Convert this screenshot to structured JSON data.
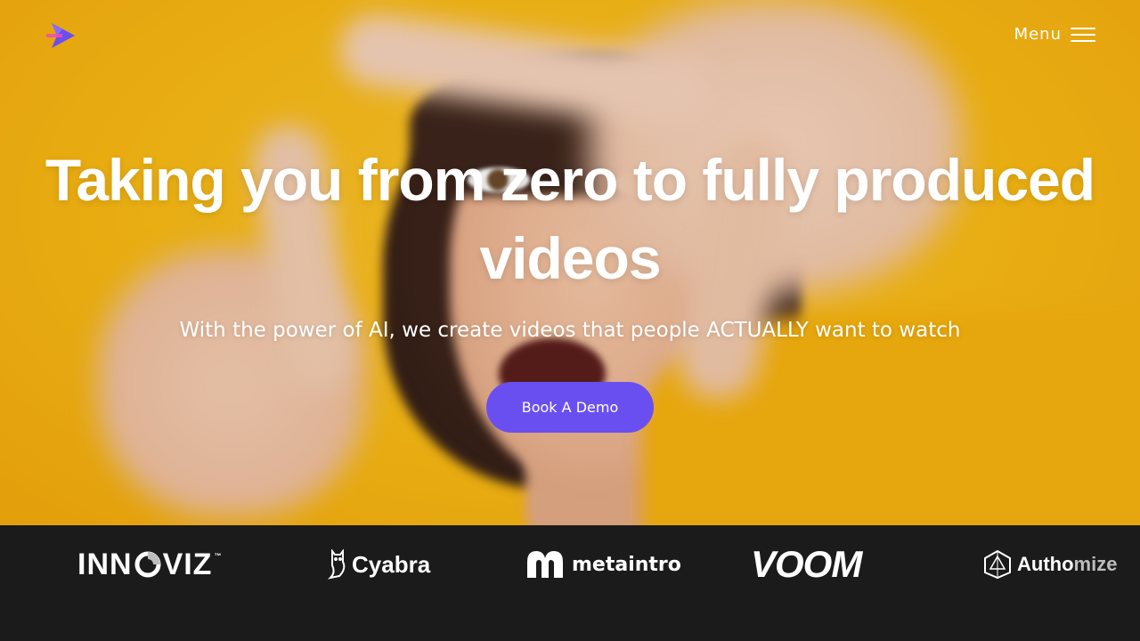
{
  "header": {
    "logo_icon": "play-arrow-logo-icon",
    "menu_label": "Menu",
    "menu_icon": "hamburger-icon"
  },
  "hero": {
    "headline": "Taking you from zero to fully produced videos",
    "subheadline": "With the power of AI, we create videos that people ACTUALLY want to watch",
    "cta_label": "Book A Demo",
    "accent_color": "#6a4ff0",
    "background_color": "#f7b814"
  },
  "clients": {
    "innoviz": {
      "name_part1": "INN",
      "name_part2": "VIZ",
      "tm": "™"
    },
    "cyabra": {
      "name": "Cyabra"
    },
    "metaintro": {
      "name": "metaintro"
    },
    "voom": {
      "name": "VOOM"
    },
    "authomize": {
      "name_part1": "Autho",
      "name_part2": "mize"
    }
  }
}
